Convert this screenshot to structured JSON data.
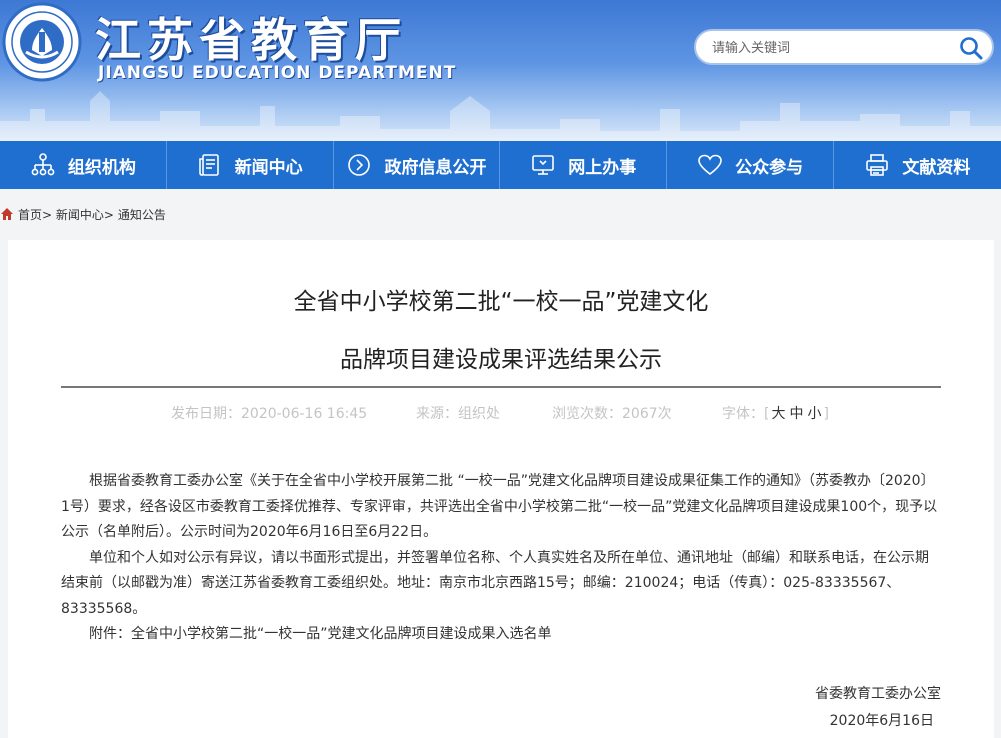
{
  "header": {
    "site_title": "江苏省教育厅",
    "site_subtitle": "JIANGSU EDUCATION DEPARTMENT",
    "search_placeholder": "请输入关键词"
  },
  "nav": [
    {
      "label": "组织机构",
      "icon": "org-chart-icon"
    },
    {
      "label": "新闻中心",
      "icon": "news-icon"
    },
    {
      "label": "政府信息公开",
      "icon": "info-disclosure-icon"
    },
    {
      "label": "网上办事",
      "icon": "monitor-icon"
    },
    {
      "label": "公众参与",
      "icon": "heart-icon"
    },
    {
      "label": "文献资料",
      "icon": "printer-icon"
    }
  ],
  "breadcrumb": {
    "home": "首页",
    "news": "新闻中心",
    "notice": "通知公告",
    "sep": ">"
  },
  "article": {
    "title_line1": "全省中小学校第二批“一校一品”党建文化",
    "title_line2": "品牌项目建设成果评选结果公示",
    "publish_date": "发布日期：2020-06-16 16:45",
    "source": "来源：组织处",
    "views": "浏览次数：2067次",
    "font_size_label": "字体：[",
    "font_large": "大",
    "font_medium": "中",
    "font_small": "小",
    "font_size_end": "]",
    "paragraphs": [
      "根据省委教育工委办公室《关于在全省中小学校开展第二批 “一校一品”党建文化品牌项目建设成果征集工作的通知》（苏委教办〔2020〕1号）要求，经各设区市委教育工委择优推荐、专家评审，共评选出全省中小学校第二批“一校一品”党建文化品牌项目建设成果100个，现予以公示（名单附后）。公示时间为2020年6月16日至6月22日。",
      "单位和个人如对公示有异议，请以书面形式提出，并签署单位名称、个人真实姓名及所在单位、通讯地址（邮编）和联系电话，在公示期结束前（以邮戳为准）寄送江苏省委教育工委组织处。地址：南京市北京西路15号；邮编：210024；电话（传真）：025-83335567、83335568。",
      "附件：全省中小学校第二批“一校一品”党建文化品牌项目建设成果入选名单"
    ],
    "signature_org": "省委教育工委办公室",
    "signature_date": "2020年6月16日"
  },
  "colors": {
    "nav_bg": "#1f6fd0",
    "header_top": "#3d78d4"
  }
}
